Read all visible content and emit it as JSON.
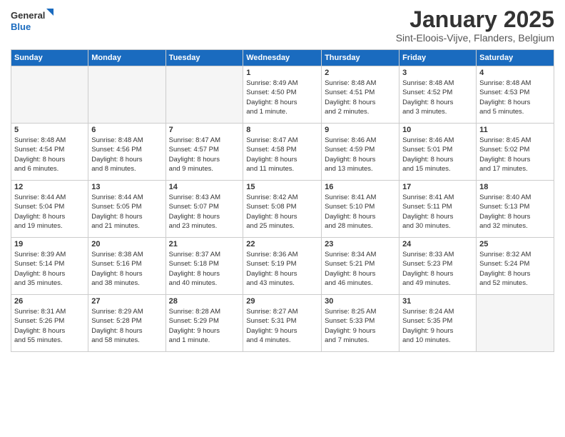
{
  "header": {
    "logo_general": "General",
    "logo_blue": "Blue",
    "title": "January 2025",
    "subtitle": "Sint-Eloois-Vijve, Flanders, Belgium"
  },
  "weekdays": [
    "Sunday",
    "Monday",
    "Tuesday",
    "Wednesday",
    "Thursday",
    "Friday",
    "Saturday"
  ],
  "weeks": [
    [
      {
        "day": "",
        "empty": true
      },
      {
        "day": "",
        "empty": true
      },
      {
        "day": "",
        "empty": true
      },
      {
        "day": "1",
        "info": "Sunrise: 8:49 AM\nSunset: 4:50 PM\nDaylight: 8 hours\nand 1 minute."
      },
      {
        "day": "2",
        "info": "Sunrise: 8:48 AM\nSunset: 4:51 PM\nDaylight: 8 hours\nand 2 minutes."
      },
      {
        "day": "3",
        "info": "Sunrise: 8:48 AM\nSunset: 4:52 PM\nDaylight: 8 hours\nand 3 minutes."
      },
      {
        "day": "4",
        "info": "Sunrise: 8:48 AM\nSunset: 4:53 PM\nDaylight: 8 hours\nand 5 minutes."
      }
    ],
    [
      {
        "day": "5",
        "info": "Sunrise: 8:48 AM\nSunset: 4:54 PM\nDaylight: 8 hours\nand 6 minutes."
      },
      {
        "day": "6",
        "info": "Sunrise: 8:48 AM\nSunset: 4:56 PM\nDaylight: 8 hours\nand 8 minutes."
      },
      {
        "day": "7",
        "info": "Sunrise: 8:47 AM\nSunset: 4:57 PM\nDaylight: 8 hours\nand 9 minutes."
      },
      {
        "day": "8",
        "info": "Sunrise: 8:47 AM\nSunset: 4:58 PM\nDaylight: 8 hours\nand 11 minutes."
      },
      {
        "day": "9",
        "info": "Sunrise: 8:46 AM\nSunset: 4:59 PM\nDaylight: 8 hours\nand 13 minutes."
      },
      {
        "day": "10",
        "info": "Sunrise: 8:46 AM\nSunset: 5:01 PM\nDaylight: 8 hours\nand 15 minutes."
      },
      {
        "day": "11",
        "info": "Sunrise: 8:45 AM\nSunset: 5:02 PM\nDaylight: 8 hours\nand 17 minutes."
      }
    ],
    [
      {
        "day": "12",
        "info": "Sunrise: 8:44 AM\nSunset: 5:04 PM\nDaylight: 8 hours\nand 19 minutes."
      },
      {
        "day": "13",
        "info": "Sunrise: 8:44 AM\nSunset: 5:05 PM\nDaylight: 8 hours\nand 21 minutes."
      },
      {
        "day": "14",
        "info": "Sunrise: 8:43 AM\nSunset: 5:07 PM\nDaylight: 8 hours\nand 23 minutes."
      },
      {
        "day": "15",
        "info": "Sunrise: 8:42 AM\nSunset: 5:08 PM\nDaylight: 8 hours\nand 25 minutes."
      },
      {
        "day": "16",
        "info": "Sunrise: 8:41 AM\nSunset: 5:10 PM\nDaylight: 8 hours\nand 28 minutes."
      },
      {
        "day": "17",
        "info": "Sunrise: 8:41 AM\nSunset: 5:11 PM\nDaylight: 8 hours\nand 30 minutes."
      },
      {
        "day": "18",
        "info": "Sunrise: 8:40 AM\nSunset: 5:13 PM\nDaylight: 8 hours\nand 32 minutes."
      }
    ],
    [
      {
        "day": "19",
        "info": "Sunrise: 8:39 AM\nSunset: 5:14 PM\nDaylight: 8 hours\nand 35 minutes."
      },
      {
        "day": "20",
        "info": "Sunrise: 8:38 AM\nSunset: 5:16 PM\nDaylight: 8 hours\nand 38 minutes."
      },
      {
        "day": "21",
        "info": "Sunrise: 8:37 AM\nSunset: 5:18 PM\nDaylight: 8 hours\nand 40 minutes."
      },
      {
        "day": "22",
        "info": "Sunrise: 8:36 AM\nSunset: 5:19 PM\nDaylight: 8 hours\nand 43 minutes."
      },
      {
        "day": "23",
        "info": "Sunrise: 8:34 AM\nSunset: 5:21 PM\nDaylight: 8 hours\nand 46 minutes."
      },
      {
        "day": "24",
        "info": "Sunrise: 8:33 AM\nSunset: 5:23 PM\nDaylight: 8 hours\nand 49 minutes."
      },
      {
        "day": "25",
        "info": "Sunrise: 8:32 AM\nSunset: 5:24 PM\nDaylight: 8 hours\nand 52 minutes."
      }
    ],
    [
      {
        "day": "26",
        "info": "Sunrise: 8:31 AM\nSunset: 5:26 PM\nDaylight: 8 hours\nand 55 minutes."
      },
      {
        "day": "27",
        "info": "Sunrise: 8:29 AM\nSunset: 5:28 PM\nDaylight: 8 hours\nand 58 minutes."
      },
      {
        "day": "28",
        "info": "Sunrise: 8:28 AM\nSunset: 5:29 PM\nDaylight: 9 hours\nand 1 minute."
      },
      {
        "day": "29",
        "info": "Sunrise: 8:27 AM\nSunset: 5:31 PM\nDaylight: 9 hours\nand 4 minutes."
      },
      {
        "day": "30",
        "info": "Sunrise: 8:25 AM\nSunset: 5:33 PM\nDaylight: 9 hours\nand 7 minutes."
      },
      {
        "day": "31",
        "info": "Sunrise: 8:24 AM\nSunset: 5:35 PM\nDaylight: 9 hours\nand 10 minutes."
      },
      {
        "day": "",
        "empty": true
      }
    ]
  ]
}
